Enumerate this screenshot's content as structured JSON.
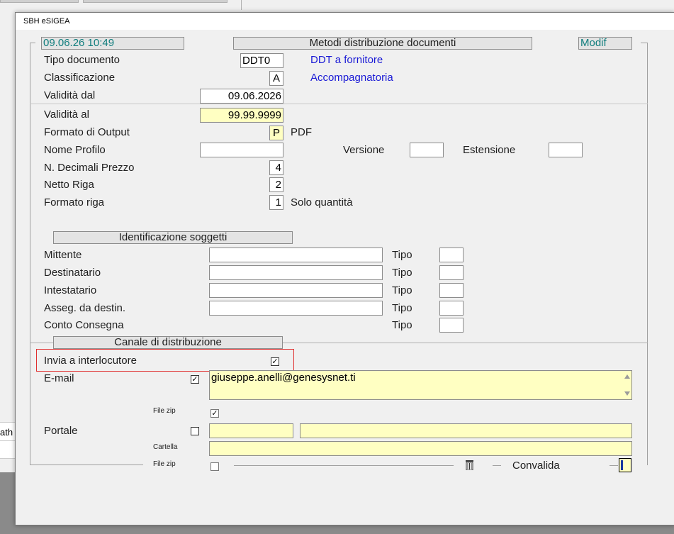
{
  "background": {
    "left_panel_text": "ath"
  },
  "window": {
    "title": "SBH eSIGEA"
  },
  "header": {
    "datetime": "09.06.26 10:49",
    "title": "Metodi distribuzione documenti",
    "mode": "Modif"
  },
  "form": {
    "tipo_documento": {
      "label": "Tipo documento",
      "value": "DDT0",
      "description": "DDT a fornitore"
    },
    "classificazione": {
      "label": "Classificazione",
      "value": "A",
      "description": "Accompagnatoria"
    },
    "validita_dal": {
      "label": "Validità dal",
      "value": "09.06.2026"
    },
    "validita_al": {
      "label": "Validità  al",
      "value": "99.99.9999"
    },
    "formato_output": {
      "label": "Formato di Output",
      "value": "P",
      "description": "PDF"
    },
    "nome_profilo": {
      "label": "Nome Profilo",
      "value": ""
    },
    "versione": {
      "label": "Versione",
      "value": ""
    },
    "estensione": {
      "label": "Estensione",
      "value": ""
    },
    "decimali_prezzo": {
      "label": "N. Decimali  Prezzo",
      "value": "4"
    },
    "netto_riga": {
      "label": "Netto Riga",
      "value": "2"
    },
    "formato_riga": {
      "label": "Formato riga",
      "value": "1",
      "description": "Solo quantità"
    }
  },
  "soggetti": {
    "section_title": "Identificazione soggetti",
    "tipo_label": "Tipo",
    "rows": [
      {
        "label": "Mittente",
        "value": "",
        "tipo": ""
      },
      {
        "label": "Destinatario",
        "value": "",
        "tipo": ""
      },
      {
        "label": "Intestatario",
        "value": "",
        "tipo": ""
      },
      {
        "label": "Asseg. da destin.",
        "value": "",
        "tipo": ""
      },
      {
        "label": "Conto Consegna",
        "tipo": ""
      }
    ]
  },
  "canale": {
    "section_title": "Canale di distribuzione",
    "invia_label": "Invia a interlocutore",
    "invia_checked": true,
    "email_label": "E-mail",
    "email_checked": true,
    "email_value": "giuseppe.anelli@genesysnet.ti",
    "file_zip_label": "File zip",
    "email_file_zip_checked": true,
    "portale_label": "Portale",
    "portale_checked": false,
    "portale_value1": "",
    "portale_value2": "",
    "cartella_label": "Cartella",
    "cartella_value": "",
    "portale_file_zip_checked": false,
    "convalida_label": "Convalida"
  },
  "icons": {
    "trash": "trash-icon",
    "convalida": "convalida-button-icon"
  },
  "colors": {
    "field_yellow": "#ffffc2",
    "blue_text": "#1a1ad6",
    "teal_text": "#0f7d7d",
    "highlight_red": "#e03030"
  }
}
